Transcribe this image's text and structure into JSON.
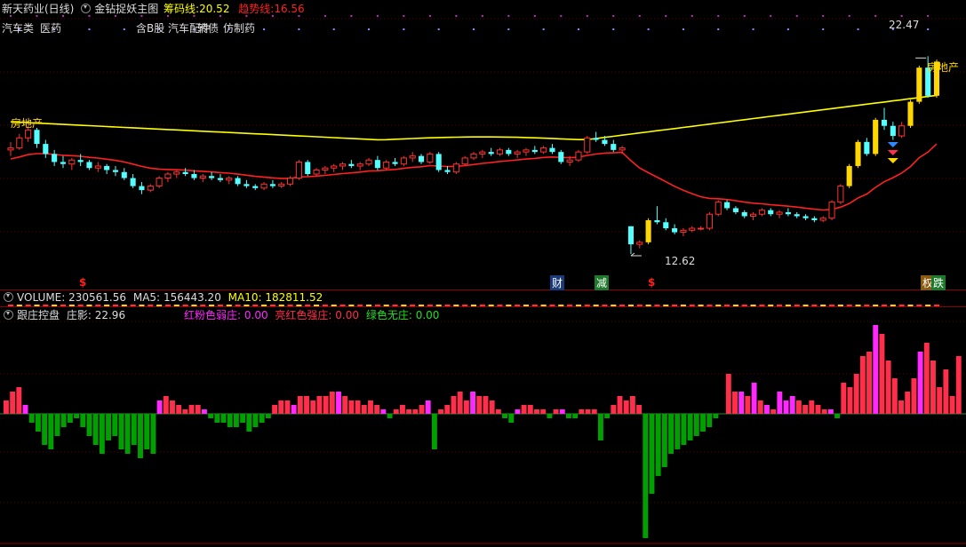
{
  "header": {
    "stock_name": "新天药业(日线)",
    "indicator_name": "金钻捉妖主图",
    "chip_label": "筹码线:",
    "chip_value": "20.52",
    "trend_label": "趋势线:",
    "trend_value": "16.56"
  },
  "concept_tags": {
    "left": [
      "汽车类",
      "医药"
    ],
    "mid_a": "含B股",
    "mid_b": "汽车配件",
    "mid_c": "转债",
    "mid_d": "仿制药"
  },
  "chart_labels": {
    "high_price": "22.47",
    "low_price": "12.62",
    "left_annotation": "房地产",
    "right_annotation": "房地产"
  },
  "signals": {
    "dollar_left": "$",
    "cai": "财",
    "jian": "减",
    "dollar_mid": "$",
    "right_a": "权",
    "right_b": "跌"
  },
  "volume_header": {
    "label": "VOLUME:",
    "value": "230561.56",
    "ma5_label": "MA5:",
    "ma5_value": "156443.20",
    "ma10_label": "MA10:",
    "ma10_value": "182811.52"
  },
  "indicator_header": {
    "name": "跟庄控盘",
    "shadow_label": "庄影:",
    "shadow_value": "22.96",
    "pink_label": "红粉色弱庄:",
    "pink_value": "0.00",
    "red_label": "亮红色强庄:",
    "red_value": "0.00",
    "green_label": "绿色无庄:",
    "green_value": "0.00"
  },
  "colors": {
    "background": "#000000",
    "up_candle": "#ff3232",
    "down_candle": "#54ffff",
    "limit_up": "#ffd700",
    "chip_line": "#ffff00",
    "trend_line": "#ff2020",
    "bar_red": "#ff2e4a",
    "bar_pink": "#ff28ff",
    "bar_green": "#00a000"
  },
  "chart_data": {
    "type": "candlestick",
    "candles": [
      [
        17.8,
        18.2,
        17.5,
        17.9
      ],
      [
        17.9,
        18.6,
        17.8,
        18.4
      ],
      [
        18.4,
        19.0,
        18.2,
        18.8
      ],
      [
        18.8,
        18.9,
        17.9,
        18.1
      ],
      [
        18.1,
        18.3,
        17.4,
        17.6
      ],
      [
        17.6,
        17.8,
        17.0,
        17.2
      ],
      [
        17.2,
        17.5,
        16.9,
        17.1
      ],
      [
        17.1,
        17.4,
        16.8,
        17.3
      ],
      [
        17.3,
        17.6,
        17.0,
        17.2
      ],
      [
        17.2,
        17.3,
        16.8,
        16.9
      ],
      [
        16.9,
        17.2,
        16.7,
        17.0
      ],
      [
        17.0,
        17.1,
        16.6,
        16.8
      ],
      [
        16.8,
        17.0,
        16.5,
        16.7
      ],
      [
        16.7,
        16.9,
        16.3,
        16.4
      ],
      [
        16.4,
        16.6,
        15.9,
        16.0
      ],
      [
        16.0,
        16.2,
        15.6,
        15.8
      ],
      [
        15.8,
        16.1,
        15.7,
        16.0
      ],
      [
        16.0,
        16.5,
        15.9,
        16.4
      ],
      [
        16.4,
        16.7,
        16.2,
        16.6
      ],
      [
        16.6,
        16.8,
        16.4,
        16.7
      ],
      [
        16.7,
        16.9,
        16.5,
        16.6
      ],
      [
        16.6,
        16.8,
        16.3,
        16.4
      ],
      [
        16.4,
        16.6,
        16.2,
        16.5
      ],
      [
        16.5,
        16.7,
        16.3,
        16.4
      ],
      [
        16.4,
        16.6,
        16.2,
        16.3
      ],
      [
        16.3,
        16.5,
        16.1,
        16.4
      ],
      [
        16.4,
        16.5,
        16.0,
        16.1
      ],
      [
        16.1,
        16.3,
        15.9,
        16.0
      ],
      [
        16.0,
        16.1,
        15.8,
        15.9
      ],
      [
        15.9,
        16.2,
        15.8,
        16.1
      ],
      [
        16.1,
        16.3,
        15.9,
        16.0
      ],
      [
        16.0,
        16.2,
        15.9,
        16.1
      ],
      [
        16.1,
        16.5,
        16.0,
        16.4
      ],
      [
        16.4,
        17.3,
        16.3,
        17.2
      ],
      [
        17.2,
        17.3,
        16.5,
        16.6
      ],
      [
        16.6,
        16.9,
        16.5,
        16.8
      ],
      [
        16.8,
        17.0,
        16.6,
        16.9
      ],
      [
        16.9,
        17.1,
        16.7,
        17.0
      ],
      [
        17.0,
        17.2,
        16.8,
        17.1
      ],
      [
        17.1,
        17.3,
        16.9,
        17.0
      ],
      [
        17.0,
        17.2,
        16.8,
        17.1
      ],
      [
        17.1,
        17.4,
        17.0,
        17.3
      ],
      [
        17.3,
        17.5,
        16.8,
        16.9
      ],
      [
        16.9,
        17.3,
        16.8,
        17.2
      ],
      [
        17.2,
        17.4,
        17.0,
        17.1
      ],
      [
        17.1,
        17.5,
        17.0,
        17.4
      ],
      [
        17.4,
        17.7,
        17.2,
        17.5
      ],
      [
        17.5,
        17.6,
        17.1,
        17.2
      ],
      [
        17.2,
        17.7,
        17.1,
        17.6
      ],
      [
        17.6,
        17.7,
        16.7,
        16.8
      ],
      [
        16.8,
        17.0,
        16.6,
        16.7
      ],
      [
        16.7,
        17.2,
        16.6,
        17.1
      ],
      [
        17.1,
        17.5,
        17.0,
        17.4
      ],
      [
        17.4,
        17.7,
        17.3,
        17.6
      ],
      [
        17.6,
        17.8,
        17.4,
        17.7
      ],
      [
        17.7,
        17.9,
        17.5,
        17.6
      ],
      [
        17.6,
        17.9,
        17.5,
        17.8
      ],
      [
        17.8,
        17.9,
        17.5,
        17.6
      ],
      [
        17.6,
        17.8,
        17.4,
        17.7
      ],
      [
        17.7,
        17.9,
        17.5,
        17.8
      ],
      [
        17.8,
        18.0,
        17.6,
        17.7
      ],
      [
        17.7,
        18.0,
        17.6,
        17.9
      ],
      [
        17.9,
        18.1,
        17.6,
        17.7
      ],
      [
        17.7,
        17.8,
        17.1,
        17.2
      ],
      [
        17.2,
        17.5,
        17.0,
        17.3
      ],
      [
        17.3,
        17.8,
        17.2,
        17.7
      ],
      [
        17.7,
        18.5,
        17.6,
        18.4
      ],
      [
        18.4,
        18.7,
        18.2,
        18.3
      ],
      [
        18.3,
        18.5,
        18.0,
        18.1
      ],
      [
        18.1,
        18.3,
        17.7,
        17.8
      ],
      [
        17.8,
        18.0,
        17.6,
        17.9
      ],
      [
        14.0,
        14.0,
        12.62,
        13.1
      ],
      [
        13.1,
        13.3,
        12.9,
        13.2
      ],
      [
        13.2,
        14.4,
        13.1,
        14.3
      ],
      [
        14.3,
        15.0,
        14.1,
        14.2
      ],
      [
        14.2,
        14.4,
        13.8,
        13.9
      ],
      [
        13.9,
        14.1,
        13.6,
        13.7
      ],
      [
        13.7,
        13.9,
        13.5,
        13.8
      ],
      [
        13.8,
        14.0,
        13.7,
        13.9
      ],
      [
        13.9,
        14.0,
        13.8,
        13.9
      ],
      [
        13.9,
        14.7,
        13.8,
        14.6
      ],
      [
        14.6,
        15.3,
        14.5,
        15.2
      ],
      [
        15.2,
        15.3,
        14.8,
        14.9
      ],
      [
        14.9,
        15.0,
        14.6,
        14.7
      ],
      [
        14.7,
        14.8,
        14.4,
        14.5
      ],
      [
        14.5,
        14.7,
        14.3,
        14.6
      ],
      [
        14.6,
        14.9,
        14.5,
        14.8
      ],
      [
        14.8,
        14.9,
        14.5,
        14.6
      ],
      [
        14.6,
        14.8,
        14.4,
        14.7
      ],
      [
        14.7,
        14.9,
        14.5,
        14.6
      ],
      [
        14.6,
        14.7,
        14.4,
        14.5
      ],
      [
        14.5,
        14.6,
        14.3,
        14.4
      ],
      [
        14.4,
        14.5,
        14.2,
        14.3
      ],
      [
        14.3,
        14.5,
        14.2,
        14.4
      ],
      [
        14.4,
        15.3,
        14.3,
        15.2
      ],
      [
        15.2,
        16.1,
        15.1,
        16.0
      ],
      [
        16.0,
        17.1,
        15.9,
        17.0
      ],
      [
        17.0,
        18.3,
        16.9,
        18.2
      ],
      [
        18.2,
        18.4,
        17.5,
        17.6
      ],
      [
        17.6,
        19.4,
        17.5,
        19.3
      ],
      [
        19.3,
        19.9,
        18.8,
        19.0
      ],
      [
        19.0,
        19.2,
        18.3,
        18.5
      ],
      [
        18.5,
        19.2,
        18.4,
        19.0
      ],
      [
        19.0,
        20.3,
        18.9,
        20.2
      ],
      [
        20.2,
        22.0,
        20.1,
        21.9
      ],
      [
        21.9,
        22.47,
        20.4,
        20.5
      ],
      [
        20.5,
        22.3,
        20.4,
        22.2
      ]
    ],
    "limit_up_indices": [
      73,
      96,
      97,
      99,
      103,
      104,
      106
    ],
    "chip_line": {
      "start": 19.2,
      "low": 18.3,
      "end": 20.52
    },
    "trend_line": {
      "start": 17.3,
      "end": 16.56
    },
    "volume_header_values": {
      "volume": 230561.56,
      "ma5": 156443.2,
      "ma10": 182811.52
    },
    "indicator_bars": [
      3,
      5,
      6,
      2,
      -2,
      -4,
      -7,
      -8,
      -5,
      -3,
      -2,
      -1,
      -3,
      -5,
      -7,
      -9,
      -6,
      -5,
      -8,
      -9,
      -7,
      -10,
      -8,
      -9,
      3,
      4,
      3,
      2,
      1,
      2,
      2,
      1,
      -1,
      -2,
      -2,
      -3,
      -3,
      -2,
      -4,
      -3,
      -2,
      -1,
      2,
      3,
      3,
      2,
      4,
      4,
      3,
      4,
      4,
      5,
      5,
      4,
      3,
      3,
      2,
      3,
      2,
      1,
      -1,
      1,
      2,
      1,
      1,
      2,
      3,
      -8,
      1,
      2,
      4,
      5,
      3,
      5,
      4,
      4,
      3,
      1,
      -1,
      -2,
      1,
      2,
      2,
      1,
      1,
      -1,
      1,
      1,
      -1,
      -1,
      1,
      1,
      1,
      -6,
      -1,
      2,
      4,
      3,
      4,
      2,
      -28,
      -18,
      -14,
      -12,
      -9,
      -8,
      -7,
      -6,
      -5,
      -4,
      -3,
      -1,
      0,
      9,
      5,
      5,
      4,
      7,
      3,
      2,
      1,
      5,
      3,
      4,
      3,
      2,
      3,
      2,
      1,
      1,
      -1,
      7,
      6,
      9,
      13,
      14,
      20,
      18,
      12,
      8,
      3,
      5,
      8,
      14,
      16,
      12,
      6,
      10,
      4,
      13
    ],
    "indicator_bar_types": "mixed",
    "price_range": [
      12.0,
      23.5
    ]
  }
}
